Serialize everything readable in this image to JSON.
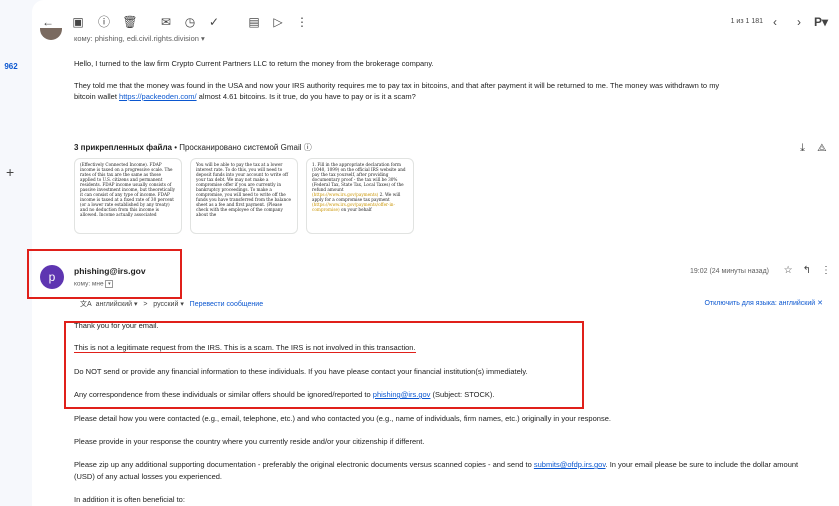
{
  "rail": {
    "badge": "962",
    "plus": "+"
  },
  "toolbar": {
    "counter": "1 из 1 181",
    "icons": [
      "back-icon",
      "archive-icon",
      "report-icon",
      "delete-icon",
      "mail-icon",
      "snooze-icon",
      "task-icon",
      "move-icon",
      "label-icon",
      "more-icon"
    ]
  },
  "email1": {
    "recipients": "кому: phishing, edi.civil.rights.division ▾",
    "line1": "Hello, I turned to the law firm Crypto Current Partners LLC to return the money from the brokerage company.",
    "line2": "They told me that the money was found in the USA and now your IRS authority requires me to pay tax in bitcoins, and that after payment it will be returned to me. The money was withdrawn to my",
    "line3_pre": "bitcoin wallet ",
    "line3_link": "https://packeoden.com/",
    "line3_post": " almost 4.61 bitcoins. Is it true, do you have to pay or is it a scam?"
  },
  "attachments": {
    "title_bold": "3 прикрепленных файла",
    "title_rest": " • Просканировано системой Gmail ⓘ",
    "thumb1": "(Effectively Connected Income). FDAP income is taxed on a progressive scale. The rates of this tax are the same as those applied to U.S. citizens and permanent residents. FDAP income usually consists of passive investment income, but theoretically it can consist of any type of income. FDAP income is taxed at a fixed rate of 30 percent (or a lower rate established by any treaty) and no deduction from this income is allowed. Income actually associated",
    "thumb2": "You will be able to pay the tax at a lower interest rate. To do this, you will need to deposit funds into your account to write off your tax debt. We may not make a compromise offer if you are currently in bankruptcy proceedings. To make a compromise, you will need to write off the funds you have transferred from the balance sheet as a fee and first payment. (Please check with the employee of the company about the",
    "thumb3_a": "1. Fill in the appropriate declaration form (1040, 1099) on the official IRS website and pay the tax yourself, after providing documentary proof - the tax will be 30% (Federal Tax, State Tax, Local Taxes) of the refund amount ",
    "thumb3_link1": "(https://www.irs.gov/payments)",
    "thumb3_b": " 2. We will apply for a compromise tax payment ",
    "thumb3_link2": "(https://www.irs.gov/payments/offer-in-compromise)",
    "thumb3_c": " on your behalf"
  },
  "email2": {
    "avatar_letter": "p",
    "sender": "phishing@irs.gov",
    "to": "кому: мне",
    "time": "19:02 (24 минуты назад)",
    "translate": {
      "from": "английский ▾",
      "arrow": ">",
      "to": "русский ▾",
      "link": "Перевести сообщение",
      "off": "Отключить для языка: английский ✕"
    },
    "p0": "Thank you for your email.",
    "p1": "This is not a legitimate request from the IRS. This is a scam. The IRS is not involved in this transaction.",
    "p2": "Do NOT send or provide any financial information to these individuals.  If you have please contact your financial institution(s) immediately.",
    "p3_pre": "Any correspondence from these individuals or similar offers should be ignored/reported to ",
    "p3_link": "phishing@irs.gov",
    "p3_post": " (Subject: STOCK).",
    "p4": "Please detail how you were contacted (e.g., email, telephone, etc.) and who contacted you (e.g., name of individuals, firm names, etc.) originally in your response.",
    "p5": "Please provide in your response the country where you currently reside and/or your citizenship if different.",
    "p6_pre": "Please zip up any additional supporting documentation - preferably the original electronic documents versus scanned copies - and send to ",
    "p6_link": "submits@ofdp.irs.gov",
    "p6_post": ".  In your email please be sure to include the dollar amount",
    "p6_line2": "(USD) of any actual losses you experienced.",
    "p7": "In addition it is often beneficial to:"
  }
}
